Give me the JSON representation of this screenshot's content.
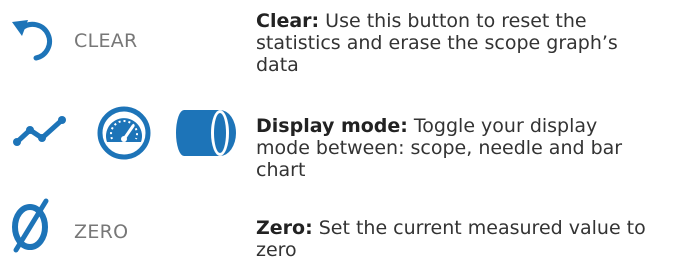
{
  "items": [
    {
      "control_label": "CLEAR",
      "icon": "undo-arrow-icon",
      "title": "Clear:",
      "text": " Use this button to reset the statistics and erase the scope graph’s data"
    },
    {
      "icons": [
        "scope-line-icon",
        "needle-gauge-icon",
        "bar-chart-icon"
      ],
      "title": "Display mode:",
      "text": " Toggle your display mode between: scope, needle and bar chart"
    },
    {
      "control_label": "ZERO",
      "icon": "zero-slash-icon",
      "title": "Zero:",
      "text": " Set the current measured value to zero"
    }
  ],
  "colors": {
    "accent": "#1d74b8",
    "label": "#777777",
    "text": "#333333"
  }
}
